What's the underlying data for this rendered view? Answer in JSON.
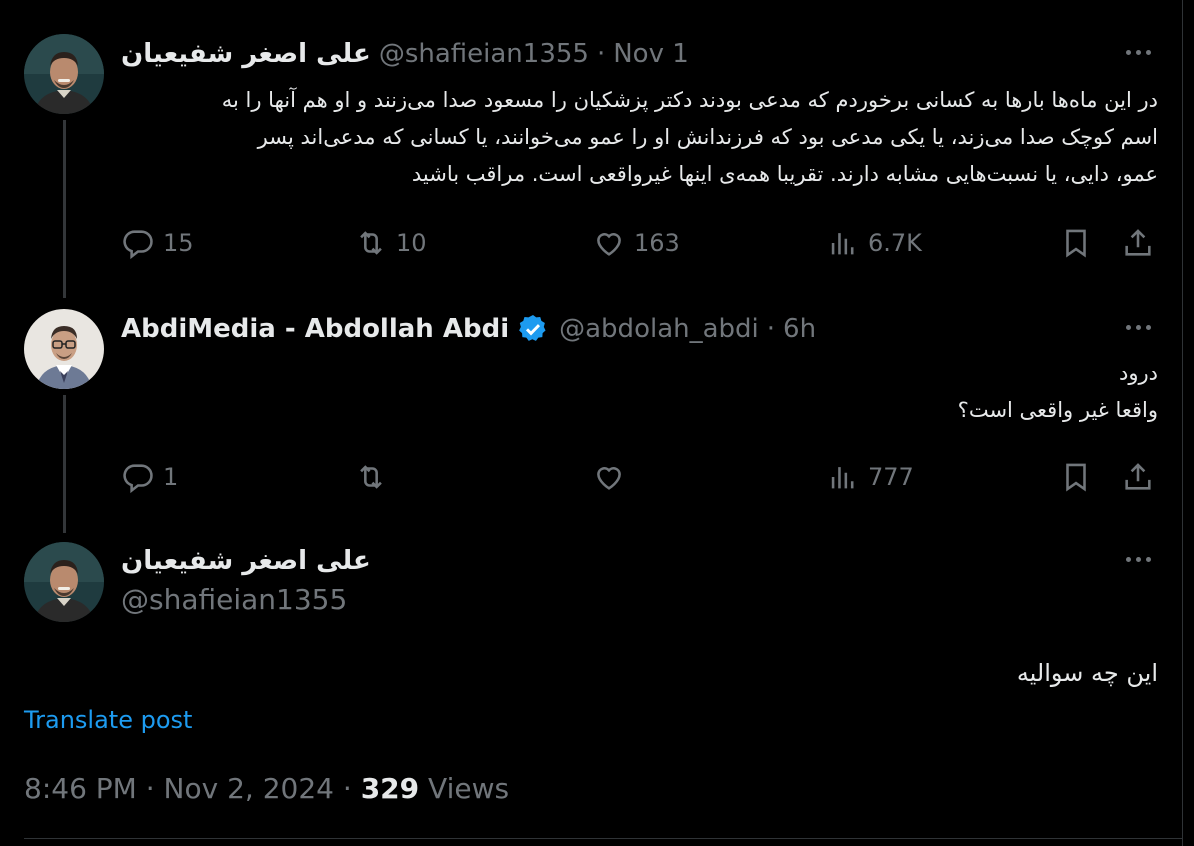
{
  "tweet1": {
    "name": "علی اصغر شفیعیان",
    "handle": "@shafieian1355",
    "separator": "·",
    "date": "Nov 1",
    "lines": [
      "در این ماه‌ها بارها به کسانی برخوردم که مدعی بودند دکتر پزشکیان را مسعود صدا می‌زنند و او هم آنها را به",
      "اسم کوچک صدا می‌زند، یا یکی مدعی بود که فرزندانش او را عمو می‌خوانند، یا کسانی که مدعی‌اند پسر",
      "عمو، دایی، یا نسبت‌هایی مشابه دارند. تقریبا همه‌ی اینها غیرواقعی است. مراقب باشید"
    ],
    "replies": "15",
    "reposts": "10",
    "likes": "163",
    "views": "6.7K"
  },
  "tweet2": {
    "name": "AbdiMedia - Abdollah Abdi",
    "handle": "@abdolah_abdi",
    "separator": "·",
    "date": "6h",
    "lines": [
      "درود",
      "واقعا غیر واقعی است؟"
    ],
    "replies": "1",
    "reposts": "",
    "likes": "",
    "views": "777"
  },
  "tweet3": {
    "name": "علی اصغر شفیعیان",
    "handle": "@shafieian1355",
    "text": "این چه سوالیه",
    "translate": "Translate post",
    "time": "8:46 PM",
    "separator": "·",
    "date": "Nov 2, 2024",
    "views_count": "329",
    "views_label": "Views"
  },
  "colors": {
    "background": "#000000",
    "text": "#e7e9ea",
    "muted": "#71767b",
    "accent": "#1d9bf0"
  },
  "icons": [
    "reply-icon",
    "repost-icon",
    "like-icon",
    "views-icon",
    "bookmark-icon",
    "share-icon",
    "more-icon",
    "verified-badge-icon"
  ]
}
